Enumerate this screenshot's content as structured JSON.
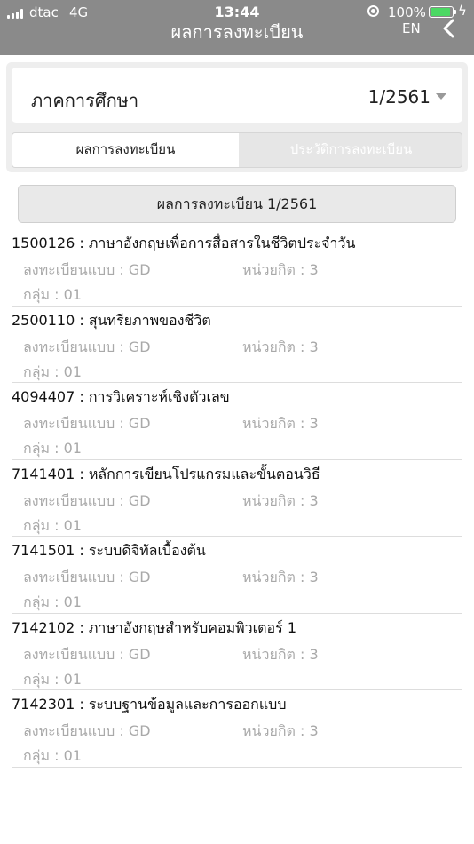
{
  "status_bar": {
    "carrier": "dtac",
    "network": "4G",
    "time": "13:44",
    "battery_percent": "100%",
    "battery_level": 1.0,
    "icons": [
      "signal-icon",
      "rotation-lock-icon",
      "battery-icon",
      "charging-icon"
    ]
  },
  "header": {
    "title": "ผลการลงทะเบียน",
    "language_toggle": "EN",
    "back_icon": "chevron-left-icon"
  },
  "semester_selector": {
    "label": "ภาคการศึกษา",
    "value": "1/2561"
  },
  "tabs": [
    {
      "label": "ผลการลงทะเบียน",
      "selected": true
    },
    {
      "label": "ประวัติการลงทะเบียน",
      "selected": false
    }
  ],
  "results_button": "ผลการลงทะเบียน 1/2561",
  "courses": [
    {
      "title": "1500126 : ภาษาอังกฤษเพื่อการสื่อสารในชีวิตประจำวัน",
      "type": "ลงทะเบียนแบบ : GD",
      "credits": "หน่วยกิต : 3",
      "group": "กลุ่ม : 01"
    },
    {
      "title": "2500110 : สุนทรียภาพของชีวิต",
      "type": "ลงทะเบียนแบบ : GD",
      "credits": "หน่วยกิต : 3",
      "group": "กลุ่ม : 01"
    },
    {
      "title": "4094407 : การวิเคราะห์เชิงตัวเลข",
      "type": "ลงทะเบียนแบบ : GD",
      "credits": "หน่วยกิต : 3",
      "group": "กลุ่ม : 01"
    },
    {
      "title": "7141401 : หลักการเขียนโปรแกรมและขั้นตอนวิธี",
      "type": "ลงทะเบียนแบบ : GD",
      "credits": "หน่วยกิต : 3",
      "group": "กลุ่ม : 01"
    },
    {
      "title": "7141501 : ระบบดิจิทัลเบื้องต้น",
      "type": "ลงทะเบียนแบบ : GD",
      "credits": "หน่วยกิต : 3",
      "group": "กลุ่ม : 01"
    },
    {
      "title": "7142102 : ภาษาอังกฤษสำหรับคอมพิวเตอร์ 1",
      "type": "ลงทะเบียนแบบ : GD",
      "credits": "หน่วยกิต : 3",
      "group": "กลุ่ม : 01"
    },
    {
      "title": "7142301 : ระบบฐานข้อมูลและการออกแบบ",
      "type": "ลงทะเบียนแบบ : GD",
      "credits": "หน่วยกิต : 3",
      "group": "กลุ่ม : 01"
    }
  ],
  "colors": {
    "header_bg": "#8a8a8a",
    "battery_fill": "#4cd964",
    "muted_text": "#a9a9a9",
    "panel_bg": "#eeeeee"
  }
}
